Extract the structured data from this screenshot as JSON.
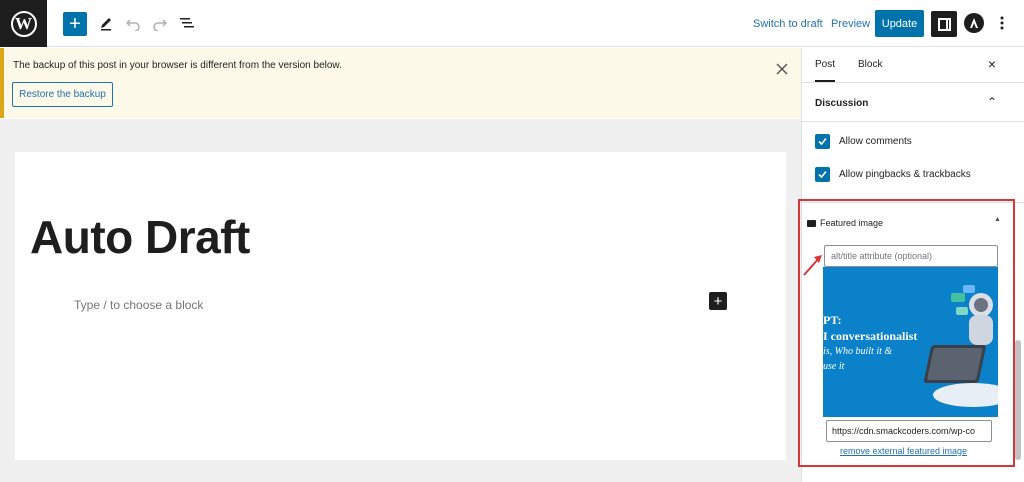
{
  "topbar": {
    "logo_icon": "wordpress-logo-icon",
    "logo_letter": "W",
    "add_block_icon": "plus-icon",
    "add_block_glyph": "+",
    "tools_icon": "pencil-icon",
    "undo_icon": "undo-icon",
    "redo_icon": "redo-icon",
    "list_view_icon": "list-view-icon",
    "switch_to_draft": "Switch to draft",
    "preview": "Preview",
    "update": "Update",
    "settings_icon": "sidebar-toggle-icon",
    "astra_icon": "astra-logo-icon",
    "more_icon": "more-vertical-icon"
  },
  "notice": {
    "text": "The backup of this post in your browser is different from the version below.",
    "restore_label": "Restore the backup",
    "close_icon": "close-icon"
  },
  "editor": {
    "title": "Auto Draft",
    "placeholder": "Type / to choose a block",
    "block_add_glyph": "+"
  },
  "sidebar": {
    "tabs": [
      {
        "label": "Post",
        "active": true
      },
      {
        "label": "Block",
        "active": false
      }
    ],
    "close_glyph": "×",
    "discussion": {
      "title": "Discussion",
      "chevron_glyph": "⌃",
      "options": [
        {
          "label": "Allow comments",
          "checked": true
        },
        {
          "label": "Allow pingbacks & trackbacks",
          "checked": true
        }
      ]
    },
    "featured_image": {
      "title": "Featured image",
      "toggle_glyph": "▲",
      "alt_placeholder": "alt/title attribute (optional)",
      "image_lines": [
        "PT:",
        "I conversationalist",
        "is, Who built it &",
        "use it"
      ],
      "url_value": "https://cdn.smackcoders.com/wp-co",
      "remove_label": "remove external featured image"
    }
  },
  "colors": {
    "accent": "#0073aa",
    "highlight": "#d63638",
    "notice_bg": "#fcf9e8",
    "notice_border": "#dba617"
  }
}
